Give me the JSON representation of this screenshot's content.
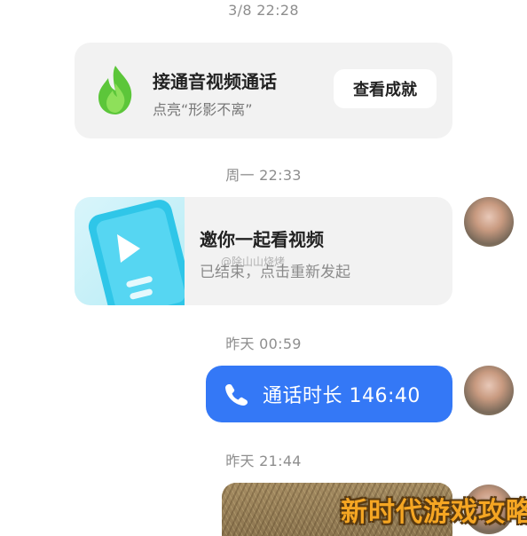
{
  "timestamps": [
    "3/8 22:28",
    "周一 22:33",
    "昨天 00:59",
    "昨天 21:44"
  ],
  "streak_card": {
    "icon": "green-flame-icon",
    "title": "接通音视频通话",
    "subtitle": "点亮“形影不离”",
    "button_label": "查看成就"
  },
  "watch_card": {
    "icon": "play-icon",
    "title": "邀你一起看视频",
    "subtitle": "已结束，点击重新发起",
    "watermark_text": "@除山山烧烤"
  },
  "call_bubble": {
    "icon": "phone-icon",
    "text": "通话时长 146:40",
    "color": "#3478f6"
  },
  "brand_watermark": "新时代游戏攻略",
  "colors": {
    "accent_blue": "#3478f6",
    "card_bg": "#f2f2f2",
    "flame_green": "#5cc63a",
    "watermark_orange": "#f5a623"
  }
}
